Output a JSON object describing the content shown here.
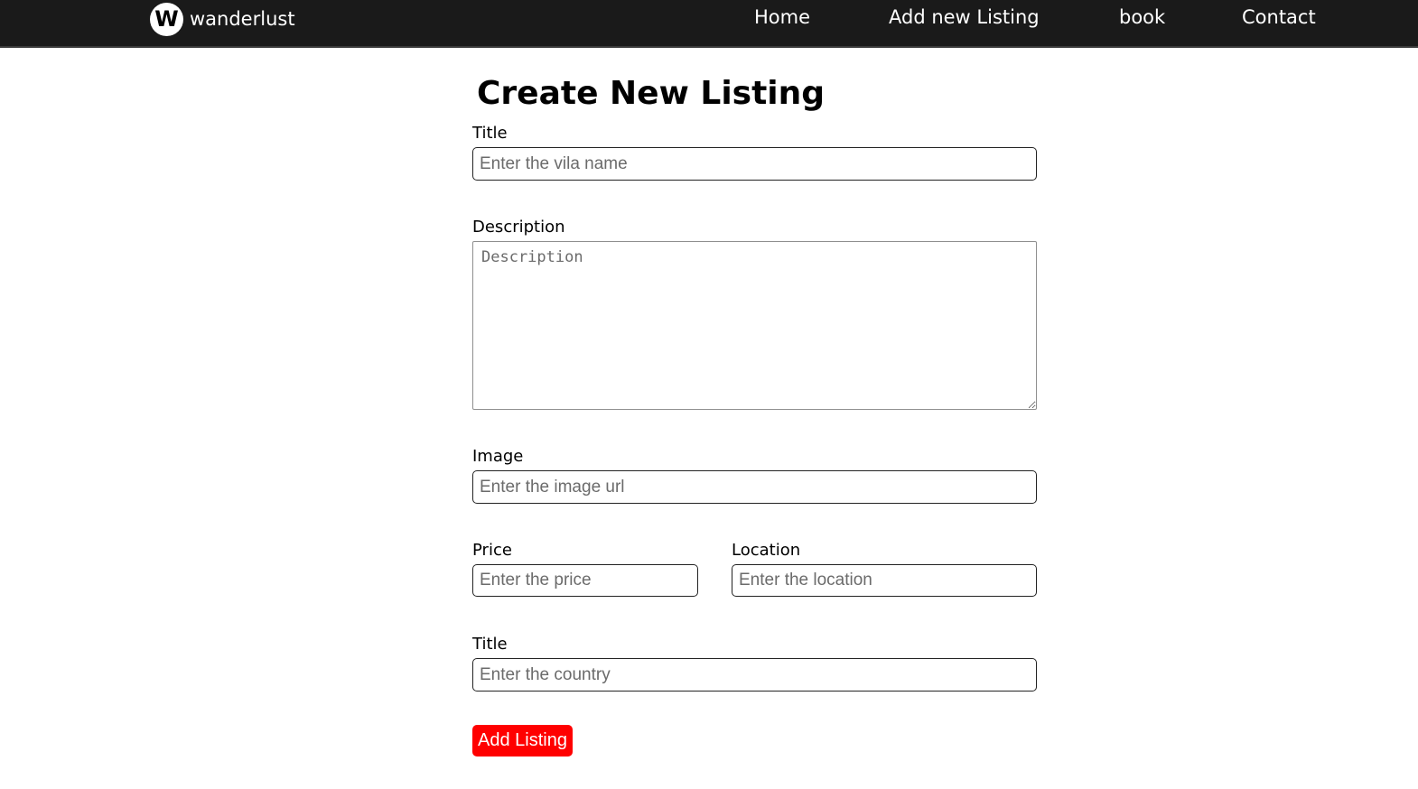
{
  "navbar": {
    "brand": {
      "logo_letter": "W",
      "name": "wanderlust"
    },
    "links": [
      {
        "label": "Home"
      },
      {
        "label": "Add new Listing"
      },
      {
        "label": "book"
      },
      {
        "label": "Contact"
      }
    ]
  },
  "form": {
    "heading": "Create New Listing",
    "title": {
      "label": "Title",
      "placeholder": "Enter the vila name",
      "value": ""
    },
    "description": {
      "label": "Description",
      "placeholder": "Description",
      "value": ""
    },
    "image": {
      "label": "Image",
      "placeholder": "Enter the image url",
      "value": ""
    },
    "price": {
      "label": "Price",
      "placeholder": "Enter the price",
      "value": ""
    },
    "location": {
      "label": "Location",
      "placeholder": "Enter the location",
      "value": ""
    },
    "country": {
      "label": "Title",
      "placeholder": "Enter the country",
      "value": ""
    },
    "submit_label": "Add Listing"
  },
  "colors": {
    "navbar_bg": "#1a1a1a",
    "submit_bg": "#ff0000",
    "text": "#000000"
  },
  "icons": {
    "brand_logo": "wanderlust-logo-icon"
  }
}
